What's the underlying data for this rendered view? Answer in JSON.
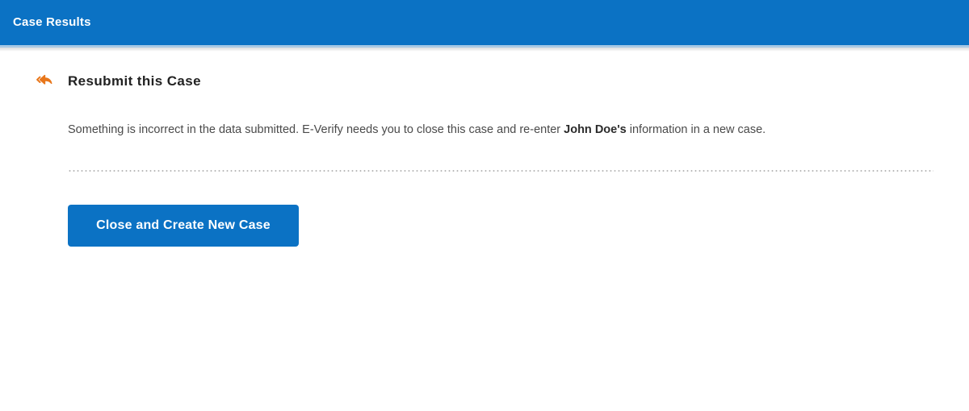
{
  "header": {
    "title": "Case Results",
    "background_color": "#0b72c4",
    "text_color": "#ffffff"
  },
  "content": {
    "section": {
      "icon_name": "reply-arrow-icon",
      "icon_color": "#e8761a",
      "heading": "Resubmit this Case",
      "paragraph": {
        "before": "Something is incorrect in the data submitted. E-Verify needs you to close this case and re-enter ",
        "emphasis": "John Doe's",
        "after": " information in a new case."
      }
    },
    "divider": {
      "style": "dotted",
      "color": "#b6b6b6"
    },
    "actions": {
      "primary_button_label": "Close and Create New Case",
      "primary_button_color": "#0b72c4"
    }
  }
}
